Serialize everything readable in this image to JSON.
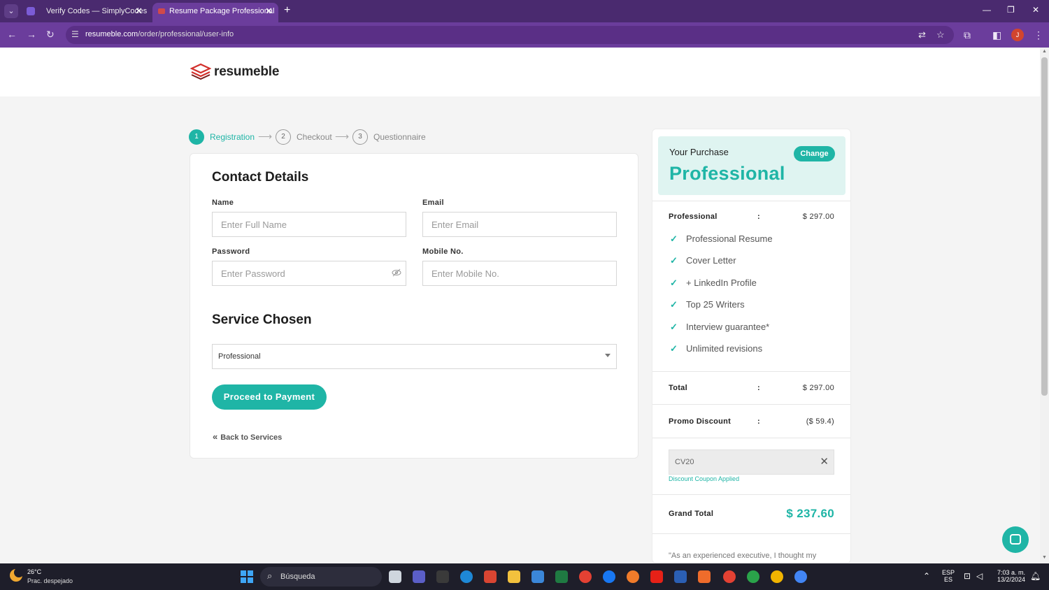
{
  "browser": {
    "tabs": [
      {
        "title": "Verify Codes — SimplyCodes",
        "close": "✕"
      },
      {
        "title": "Resume Package Professional -",
        "close": "✕"
      }
    ],
    "new_tab": "+",
    "url_domain": "resumeble.com",
    "url_path": "/order/professional/user-info",
    "profile_initial": "J"
  },
  "site": {
    "logo_text": "resumeble"
  },
  "steps": [
    {
      "num": "1",
      "label": "Registration"
    },
    {
      "num": "2",
      "label": "Checkout"
    },
    {
      "num": "3",
      "label": "Questionnaire"
    }
  ],
  "form": {
    "contact_title": "Contact Details",
    "name_label": "Name",
    "name_placeholder": "Enter Full Name",
    "email_label": "Email",
    "email_placeholder": "Enter Email",
    "password_label": "Password",
    "password_placeholder": "Enter Password",
    "mobile_label": "Mobile No.",
    "mobile_placeholder": "Enter Mobile No.",
    "service_title": "Service Chosen",
    "service_value": "Professional",
    "proceed_label": "Proceed to Payment",
    "back_label": "Back to Services"
  },
  "summary": {
    "your_purchase": "Your Purchase",
    "package": "Professional",
    "change_label": "Change",
    "line_label": "Professional",
    "line_amount": "$ 297.00",
    "colon": ":",
    "features": [
      "Professional Resume",
      "Cover Letter",
      "+ LinkedIn Profile",
      "Top 25 Writers",
      "Interview guarantee*",
      "Unlimited revisions"
    ],
    "total_label": "Total",
    "total_amount": "$ 297.00",
    "promo_label": "Promo Discount",
    "promo_amount": "($ 59.4)",
    "coupon_code": "CV20",
    "coupon_status": "Discount Coupon Applied",
    "grand_label": "Grand Total",
    "grand_amount": "$ 237.60",
    "quote": "\"As an experienced executive, I thought my"
  },
  "taskbar": {
    "temp": "26°C",
    "weather": "Prac. despejado",
    "search_label": "Búsqueda",
    "lang_top": "ESP",
    "lang_bottom": "ES",
    "time": "7:03 a. m.",
    "date": "13/2/2024"
  },
  "colors": {
    "accent": "#1fb5a6",
    "browser_frame": "#4a2a6f",
    "taskbar": "#1e1e2a"
  }
}
